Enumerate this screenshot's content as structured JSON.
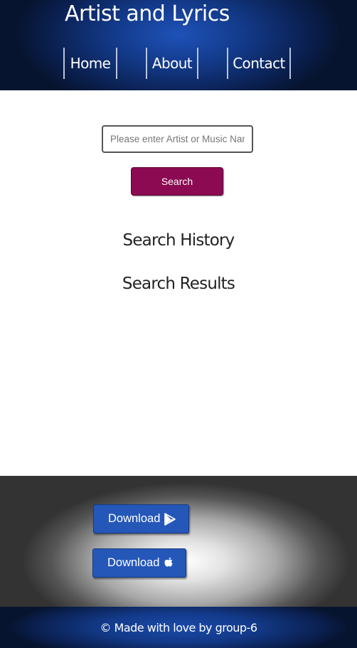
{
  "header": {
    "title": "Artist and Lyrics",
    "nav": [
      {
        "label": "Home"
      },
      {
        "label": "About"
      },
      {
        "label": "Contact"
      }
    ]
  },
  "search": {
    "placeholder": "Please enter Artist or Music Name",
    "value": "",
    "button_label": "Search"
  },
  "sections": {
    "history_heading": "Search History",
    "results_heading": "Search Results"
  },
  "downloads": [
    {
      "label": "Download",
      "icon": "play-store-icon"
    },
    {
      "label": "Download",
      "icon": "apple-icon"
    }
  ],
  "footer": {
    "text": "© Made with love by group-6"
  },
  "colors": {
    "header_blue": "#133a8a",
    "search_button": "#8b0a52",
    "download_button": "#2457b8"
  }
}
